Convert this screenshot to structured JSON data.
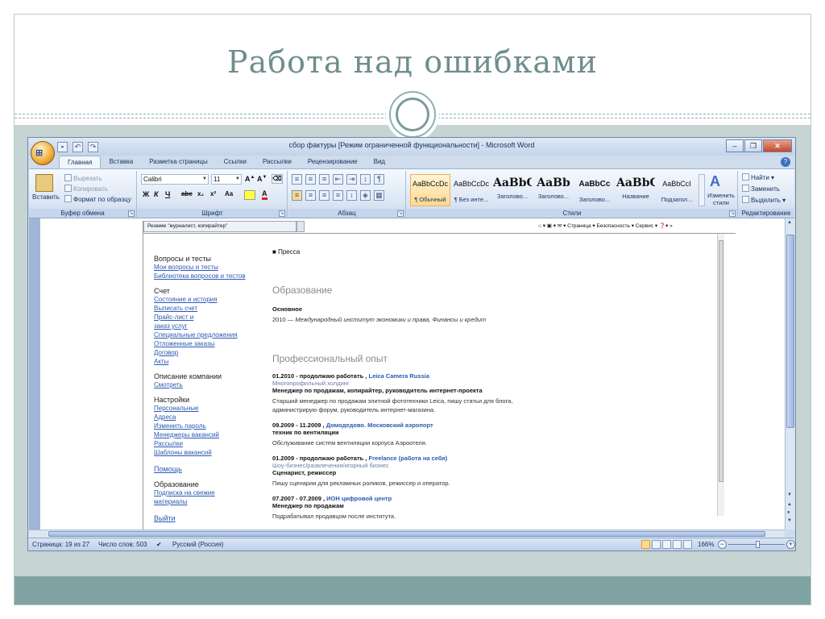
{
  "slide": {
    "title": "Работа над ошибками"
  },
  "word": {
    "window_title": "сбор фактуры [Режим ограниченной функциональности] - Microsoft Word",
    "office_button": "Office",
    "tabs": [
      "Главная",
      "Вставка",
      "Разметка страницы",
      "Ссылки",
      "Рассылки",
      "Рецензирование",
      "Вид"
    ],
    "ribbon": {
      "clipboard": {
        "label": "Буфер обмена",
        "paste": "Вставить",
        "cut": "Вырезать",
        "copy": "Копировать",
        "format_painter": "Формат по образцу"
      },
      "font": {
        "label": "Шрифт",
        "family": "Calibri",
        "size": "11",
        "bold": "Ж",
        "italic": "К",
        "underline": "Ч",
        "strike": "abe",
        "subscript": "x₂",
        "superscript": "x²",
        "case": "Aa"
      },
      "paragraph": {
        "label": "Абзац"
      },
      "styles": {
        "label": "Стили",
        "items": [
          {
            "sample": "AaBbCcDc",
            "name": "¶ Обычный"
          },
          {
            "sample": "AaBbCcDc",
            "name": "¶ Без инте..."
          },
          {
            "sample": "AaBbC",
            "name": "Заголово..."
          },
          {
            "sample": "AaBb",
            "name": "Заголово..."
          },
          {
            "sample": "AaBbCc",
            "name": "Заголово..."
          },
          {
            "sample": "AaBbC",
            "name": "Название"
          },
          {
            "sample": "AaBbCcI",
            "name": "Подзагол..."
          }
        ],
        "change_styles": "Изменить стили"
      },
      "editing": {
        "label": "Редактирование",
        "find": "Найти",
        "replace": "Заменить",
        "select": "Выделить"
      }
    },
    "status": {
      "page": "Страница: 19 из 27",
      "words": "Число слов: 503",
      "language": "Русский (Россия)",
      "zoom": "166%"
    }
  },
  "embedded": {
    "tab_title": "Резюме \"журналист, копирайтер\"",
    "toolbar": "Страница ▾  Безопасность ▾  Сервис ▾",
    "nav": [
      {
        "heading": "Вопросы и тесты",
        "links": [
          "Мои вопросы и тесты",
          "Библиотека вопросов и тестов"
        ]
      },
      {
        "heading": "Счет",
        "links": [
          "Состояние и история",
          "Выписать счет",
          "Прайс-лист и",
          "заказ услуг",
          "Специальные предложения",
          "Отложенные заказы",
          "Договор",
          "Акты"
        ]
      },
      {
        "heading": "Описание компании",
        "links": [
          "Смотреть"
        ]
      },
      {
        "heading": "Настройки",
        "links": [
          "Персональные",
          "Адреса",
          "Изменить пароль",
          "Менеджеры вакансий",
          "Рассылки",
          "Шаблоны вакансий"
        ]
      },
      {
        "heading": "",
        "links": [
          "Помощь"
        ]
      },
      {
        "heading": "Образование",
        "links": [
          "Подписка на свежие",
          "материалы"
        ]
      },
      {
        "heading": "",
        "links": [
          "Выйти"
        ]
      }
    ],
    "resume": {
      "bullet": "Пресса",
      "education_title": "Образование",
      "education_level": "Основное",
      "education_year": "2010",
      "education_text": "Международный институт экономики и права, Финансы и кредит",
      "experience_title": "Профессиональный опыт",
      "jobs": [
        {
          "period": "01.2010 - продолжаю работать ,",
          "company": "Leica Camera Russia",
          "org": "Многопрофильный холдинг",
          "position": "Менеджер по продажам, копирайтер, руководитель интернет-проекта",
          "desc": "Старший менеджер по продажам элитной фототехники Leica, пишу статьи для блога, администрирую форум, руководитель интернет-магазина."
        },
        {
          "period": "09.2009 - 11.2009 ,",
          "company": "Домодедово. Московский аэропорт",
          "org": "",
          "position": "техник по вентиляции",
          "desc": "Обслуживание систем вентиляции корпуса Аэроотеля."
        },
        {
          "period": "01.2009 - продолжаю работать ,",
          "company": "Freelance (работа на себя)",
          "org": "Шоу-бизнес/развлечения/игорный бизнес",
          "position": "Сценарист, режиссер",
          "desc": "Пишу сценарии для рекламных роликов, режиссер и оператор."
        },
        {
          "period": "07.2007 - 07.2009 ,",
          "company": "ИОН цифровой центр",
          "org": "",
          "position": "Менеджер по продажам",
          "desc": "Подрабатывал продавцом после института."
        }
      ]
    }
  },
  "colors": {
    "title": "#6f8e8d",
    "band": "#c7d4d4",
    "bottom_band": "#7ea3a2",
    "link": "#2b59b3"
  }
}
